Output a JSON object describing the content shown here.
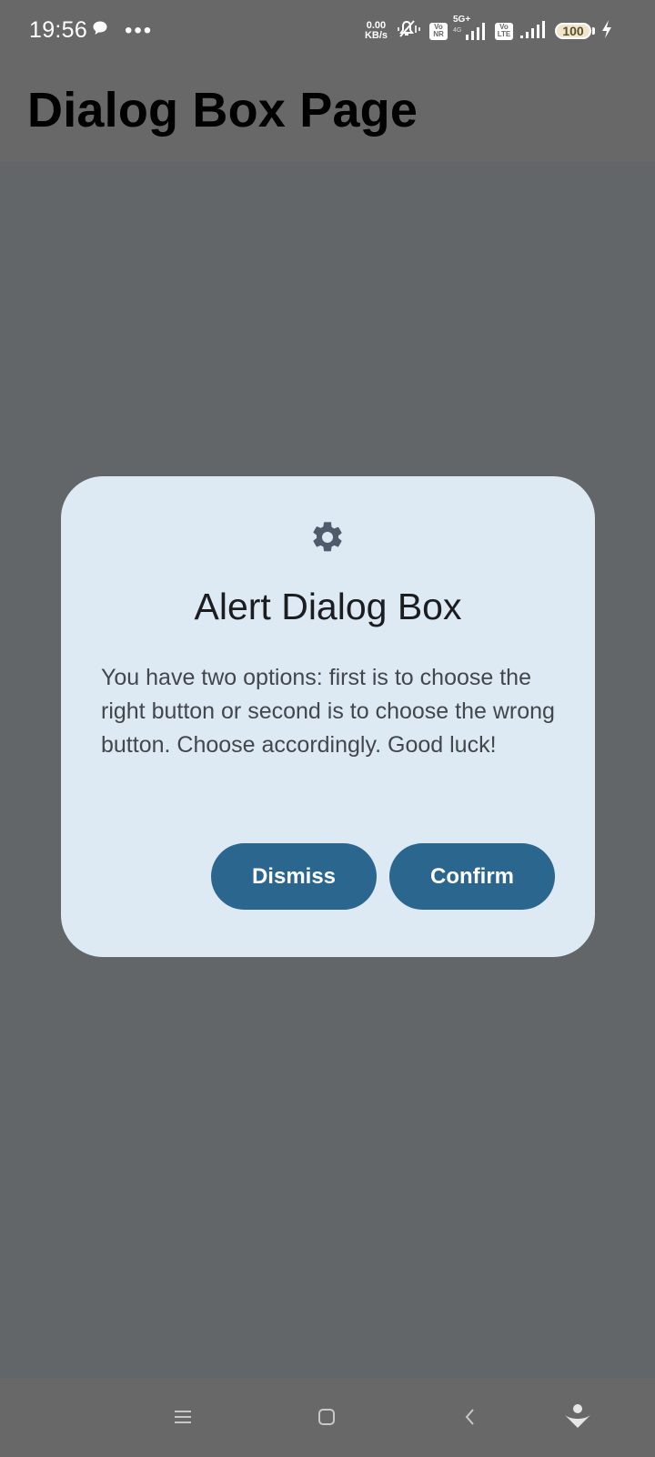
{
  "status_bar": {
    "time": "19:56",
    "overflow_indicator": "•••",
    "net_speed_value": "0.00",
    "net_speed_unit": "KB/s",
    "sim1_badge_top": "Vo",
    "sim1_badge_bottom": "NR",
    "sim1_network": "5G+",
    "sim1_sub": "4G",
    "sim2_badge_top": "Vo",
    "sim2_badge_bottom": "LTE",
    "battery_level": "100",
    "icons": [
      "chat-bubble-icon",
      "mute-vibrate-icon",
      "signal-icon",
      "battery-icon",
      "charging-bolt-icon"
    ]
  },
  "app_bar": {
    "title": "Dialog Box Page"
  },
  "dialog": {
    "icon": "gear-icon",
    "title": "Alert Dialog Box",
    "body": "You have two options: first is to choose the right button or second is to choose the wrong button. Choose accordingly. Good luck!",
    "dismiss_label": "Dismiss",
    "confirm_label": "Confirm"
  },
  "nav_bar": {
    "icons": [
      "recents-icon",
      "home-icon",
      "back-icon",
      "assistant-icon"
    ]
  },
  "colors": {
    "scrim": "#636669",
    "bars": "#686868",
    "dialog_surface": "#dde9f3",
    "button": "#2b668f",
    "title_text": "#1b1d20",
    "body_text": "#43474d",
    "icon": "#4d5b6b"
  }
}
